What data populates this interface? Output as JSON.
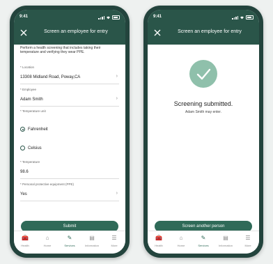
{
  "status_time": "9:41",
  "screen_title": "Screen an employee for entry",
  "form": {
    "intro": "Perform a health screening that includes taking their temperature and verifying they wear PPE.",
    "location_label": "* Location",
    "location_value": "13308 Midland Road, Poway,CA",
    "employee_label": "* Employee",
    "employee_value": "Adam Smith",
    "temp_unit_label": "* Temperature unit",
    "unit_options": [
      "Fahrenheit",
      "Celsius"
    ],
    "unit_selected": "Fahrenheit",
    "temperature_label": "* Temperature",
    "temperature_value": "98.6",
    "ppe_label": "* Personal protective equipment (PPE)",
    "ppe_value": "Yes",
    "submit_label": "Submit"
  },
  "confirmation": {
    "title": "Screening submitted.",
    "subtitle": "Adam Smith may enter.",
    "button_label": "Screen another person"
  },
  "tabs": [
    {
      "label": "Health",
      "icon": "health-kit-icon"
    },
    {
      "label": "Home",
      "icon": "home-icon"
    },
    {
      "label": "Services",
      "icon": "services-icon"
    },
    {
      "label": "Information",
      "icon": "document-icon"
    },
    {
      "label": "More",
      "icon": "menu-icon"
    }
  ],
  "active_tab": "Services",
  "colors": {
    "header": "#2a5549",
    "accent": "#2f6a58",
    "phone_body": "#23443d",
    "check_circle": "#8fc0ab"
  }
}
